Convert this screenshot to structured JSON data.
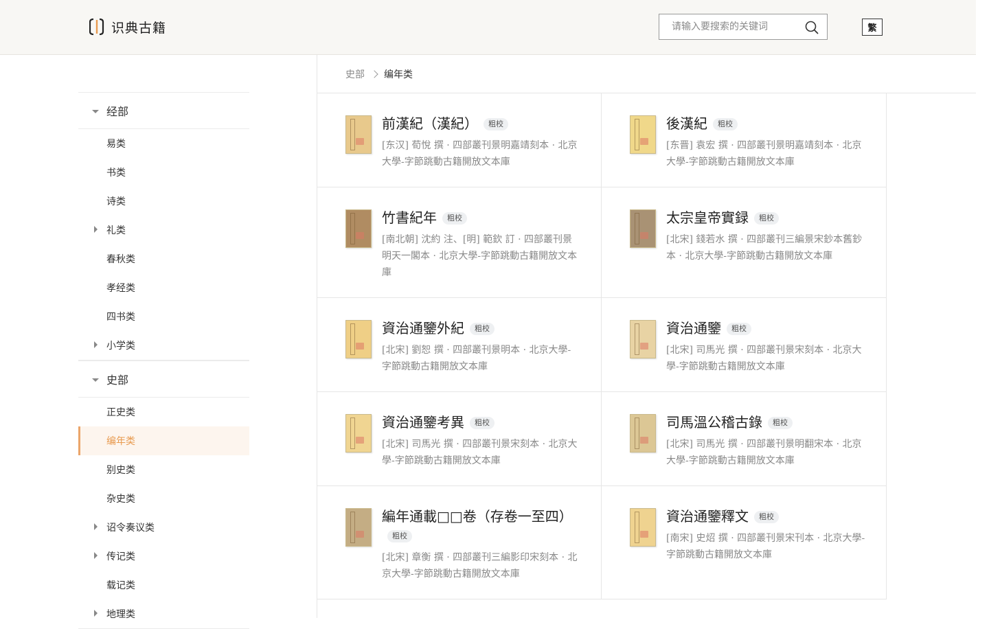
{
  "header": {
    "logo_text": "识典古籍",
    "search_placeholder": "请输入要搜索的关键词",
    "lang_toggle": "繁"
  },
  "breadcrumb": {
    "parent": "史部",
    "current": "编年类"
  },
  "sidebar": {
    "groups": [
      {
        "label": "经部",
        "expanded": true,
        "items": [
          {
            "label": "易类"
          },
          {
            "label": "书类"
          },
          {
            "label": "诗类"
          },
          {
            "label": "礼类",
            "has_children": true
          },
          {
            "label": "春秋类"
          },
          {
            "label": "孝经类"
          },
          {
            "label": "四书类"
          },
          {
            "label": "小学类",
            "has_children": true
          }
        ]
      },
      {
        "label": "史部",
        "expanded": true,
        "items": [
          {
            "label": "正史类"
          },
          {
            "label": "编年类",
            "active": true
          },
          {
            "label": "别史类"
          },
          {
            "label": "杂史类"
          },
          {
            "label": "诏令奏议类",
            "has_children": true
          },
          {
            "label": "传记类",
            "has_children": true
          },
          {
            "label": "载记类"
          },
          {
            "label": "地理类",
            "has_children": true
          }
        ]
      }
    ]
  },
  "colors": {
    "accent": "#eba56a",
    "active_bg": "#fdf5ee",
    "active_text": "#e89a4f"
  },
  "books": [
    {
      "title": "前漢紀（漢紀）",
      "badge": "粗校",
      "meta": "[东汉] 荀悅 撰 · 四部叢刊景明嘉靖刻本 · 北京大學-字節跳動古籍開放文本庫",
      "cover": "#e8c98c"
    },
    {
      "title": "後漢紀",
      "badge": "粗校",
      "meta": "[东晋] 袁宏 撰 · 四部叢刊景明嘉靖刻本 · 北京大學-字節跳動古籍開放文本庫",
      "cover": "#f0d88a"
    },
    {
      "title": "竹書紀年",
      "badge": "粗校",
      "meta": "[南北朝] 沈約 注、[明] 範欽 訂 · 四部叢刊景明天一閣本 · 北京大學-字節跳動古籍開放文本庫",
      "cover": "#b08c62"
    },
    {
      "title": "太宗皇帝實録",
      "badge": "粗校",
      "meta": "[北宋] 錢若水 撰 · 四部叢刊三編景宋鈔本舊鈔本 · 北京大學-字節跳動古籍開放文本庫",
      "cover": "#a99274"
    },
    {
      "title": "資治通鑒外紀",
      "badge": "粗校",
      "meta": "[北宋] 劉恕 撰 · 四部叢刊景明本 · 北京大學-字節跳動古籍開放文本庫",
      "cover": "#efcf86"
    },
    {
      "title": "資治通鑒",
      "badge": "粗校",
      "meta": "[北宋] 司馬光 撰 · 四部叢刊景宋刻本 · 北京大學-字節跳動古籍開放文本庫",
      "cover": "#e8d3a4"
    },
    {
      "title": "資治通鑒考異",
      "badge": "粗校",
      "meta": "[北宋] 司馬光 撰 · 四部叢刊景宋刻本 · 北京大學-字節跳動古籍開放文本庫",
      "cover": "#f0d592"
    },
    {
      "title": "司馬溫公稽古錄",
      "badge": "粗校",
      "meta": "[北宋] 司馬光 撰 · 四部叢刊景明翻宋本 · 北京大學-字節跳動古籍開放文本庫",
      "cover": "#dcc795"
    },
    {
      "title": "編年通載□□卷（存卷一至四）",
      "badge": "粗校",
      "meta": "[北宋] 章衡 撰 · 四部叢刊三編影印宋刻本 · 北京大學-字節跳動古籍開放文本庫",
      "cover": "#c4ad84"
    },
    {
      "title": "資治通鑒釋文",
      "badge": "粗校",
      "meta": "[南宋] 史炤 撰 · 四部叢刊景宋刊本 · 北京大學-字節跳動古籍開放文本庫",
      "cover": "#efd390"
    }
  ]
}
